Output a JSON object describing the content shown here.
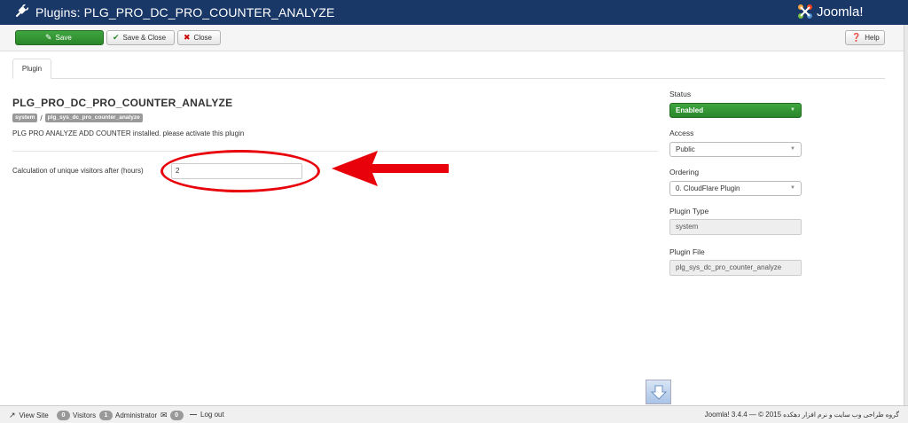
{
  "header": {
    "title": "Plugins: PLG_PRO_DC_PRO_COUNTER_ANALYZE",
    "title_icon": "power-cord-icon",
    "logo_text": "Joomla!",
    "logo_icon": "joomla-logo-icon",
    "bg_color": "#1a3867"
  },
  "toolbar": {
    "save_label": "Save",
    "save_close_label": "Save & Close",
    "close_label": "Close",
    "help_label": "Help",
    "save_color": "#2f962f"
  },
  "tabs": [
    {
      "label": "Plugin",
      "active": true
    }
  ],
  "plugin": {
    "title": "PLG_PRO_DC_PRO_COUNTER_ANALYZE",
    "badge_group": "system",
    "badge_separator": "/",
    "badge_element": "plg_sys_dc_pro_counter_analyze",
    "description": "PLG PRO ANALYZE ADD COUNTER installed. please activate this plugin"
  },
  "fields": {
    "unique_visitors_label": "Calculation of unique visitors after (hours)",
    "unique_visitors_value": "2"
  },
  "annotation": {
    "color": "#e8000b",
    "shapes": [
      "ellipse",
      "arrow"
    ]
  },
  "sidebar": {
    "status_label": "Status",
    "status_value": "Enabled",
    "access_label": "Access",
    "access_value": "Public",
    "ordering_label": "Ordering",
    "ordering_value": "0. CloudFlare Plugin",
    "plugin_type_label": "Plugin Type",
    "plugin_type_value": "system",
    "plugin_file_label": "Plugin File",
    "plugin_file_value": "plg_sys_dc_pro_counter_analyze"
  },
  "statusbar": {
    "view_site_label": "View Site",
    "visitors_count": "0",
    "visitors_label": "Visitors",
    "admin_count": "1",
    "admin_label": "Administrator",
    "messages_count": "0",
    "logout_label": "Log out",
    "version_text": "Joomla! 3.4.4 — © 2015",
    "rtl_text": "گروه طراحی وب سایت و نرم افزار دهکده"
  }
}
